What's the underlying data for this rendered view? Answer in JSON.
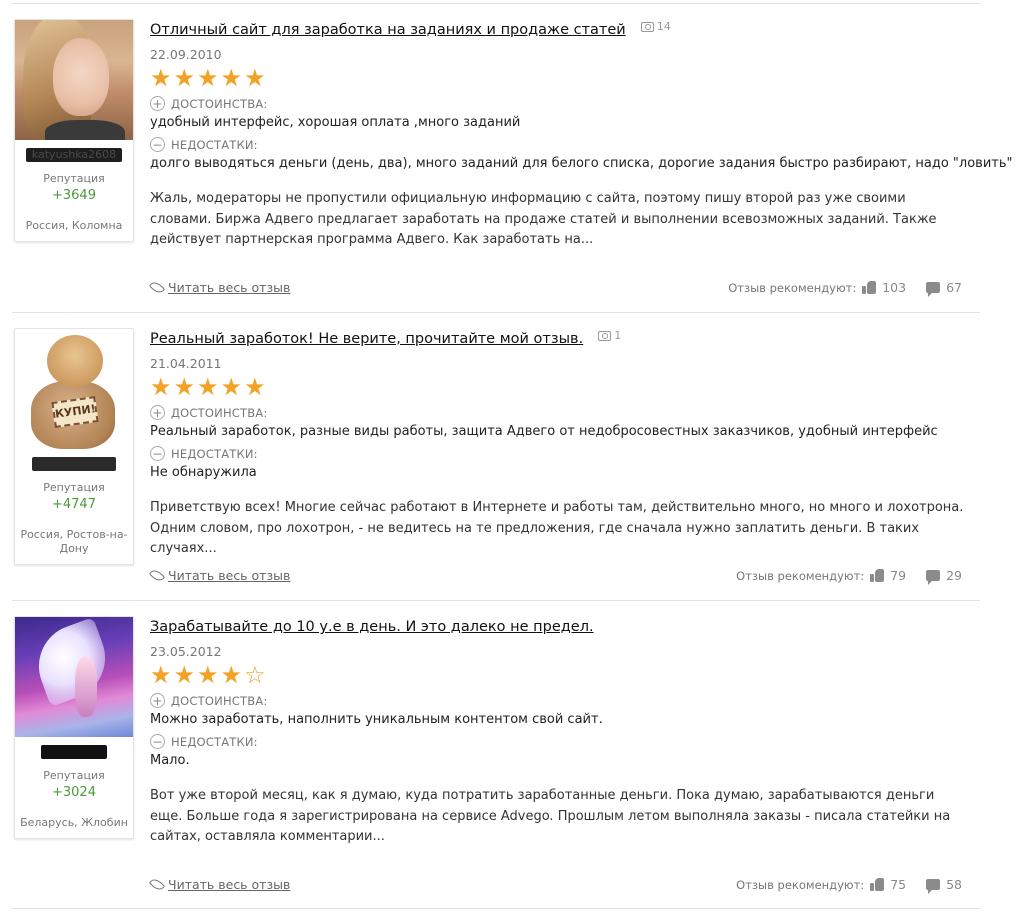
{
  "reviews": [
    {
      "user": {
        "nickname": "katyushka2608",
        "reputation_label": "Репутация",
        "reputation": "+3649",
        "location": "Россия, Коломна"
      },
      "title": "Отличный сайт для заработка на заданиях и продаже статей",
      "photos": "14",
      "date": "22.09.2010",
      "rating": 5,
      "stars": "★★★★★",
      "pros_label": "ДОСТОИНСТВА:",
      "pros": "удобный интерфейс, хорошая оплата ,много заданий",
      "cons_label": "НЕДОСТАТКИ:",
      "cons": "долго выводяться деньги (день, два), много заданий для белого списка, дорогие задания быстро разбирают, надо \"ловить\"",
      "body": "Жаль, модераторы не пропустили официальную информацию с сайта, поэтому пишу второй раз уже своими словами. Биржа Адвего предлагает заработать на продаже статей и выполнении всевозможных заданий. Также действует партнерская программа Адвего. Как заработать на...",
      "read_more": "Читать весь отзыв",
      "recommend_label": "Отзыв рекомендуют:",
      "likes": "103",
      "comments": "67"
    },
    {
      "user": {
        "nickname": "",
        "reputation_label": "Репутация",
        "reputation": "+4747",
        "location": "Россия, Ростов-на-Дону"
      },
      "title": "Реальный заработок! Не верите, прочитайте мой отзыв.",
      "photos": "1",
      "date": "21.04.2011",
      "rating": 5,
      "stars": "★★★★★",
      "pros_label": "ДОСТОИНСТВА:",
      "pros": "Реальный заработок, разные виды работы, защита Адвего от недобросовестных заказчиков, удобный интерфейс",
      "cons_label": "НЕДОСТАТКИ:",
      "cons": "Не обнаружила",
      "body": "Приветствую всех! Многие сейчас работают в Интернете и работы там, действительно много, но много и лохотрона. Одним словом, про лохотрон, - не ведитесь на те предложения, где сначала нужно заплатить деньги. В таких случаях...",
      "read_more": "Читать весь отзыв",
      "recommend_label": "Отзыв рекомендуют:",
      "likes": "79",
      "comments": "29",
      "avatar_tag": "КУПИ!"
    },
    {
      "user": {
        "nickname": "",
        "reputation_label": "Репутация",
        "reputation": "+3024",
        "location": "Беларусь, Жлобин"
      },
      "title": "Зарабатывайте до 10 у.е в день. И это далеко не предел.",
      "photos": "",
      "date": "23.05.2012",
      "rating": 4,
      "stars": "★★★★",
      "stars_empty": "☆",
      "pros_label": "ДОСТОИНСТВА:",
      "pros": "Можно заработать, наполнить уникальным контентом свой сайт.",
      "cons_label": "НЕДОСТАТКИ:",
      "cons": "Мало.",
      "body": "Вот уже второй месяц, как я думаю, куда потратить заработанные деньги. Пока думаю, зарабатываются деньги еще. Больше года я зарегистрирована на сервисе Advego. Прошлым летом выполняла заказы - писала статейки на сайтах, оставляла комментарии...",
      "read_more": "Читать весь отзыв",
      "recommend_label": "Отзыв рекомендуют:",
      "likes": "75",
      "comments": "58"
    }
  ],
  "icons": {
    "plus": "+",
    "minus": "−"
  },
  "colors": {
    "star": "#f2a226",
    "reputation": "#4b9a3a",
    "divider": "#e2e2e2"
  }
}
